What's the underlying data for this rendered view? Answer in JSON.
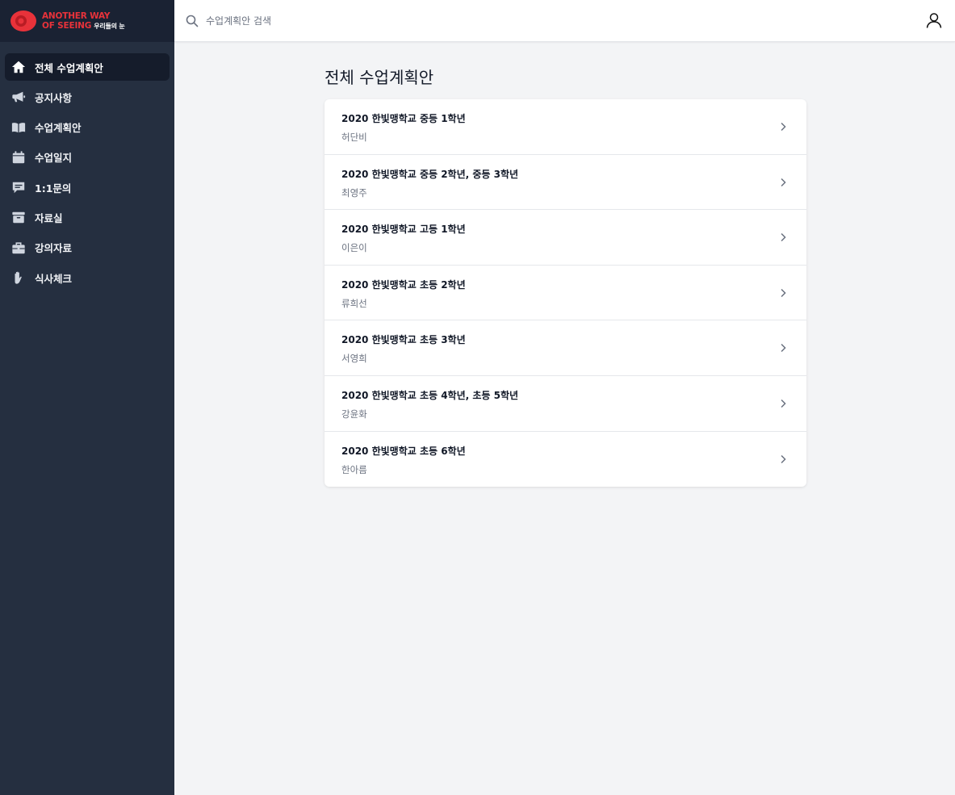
{
  "brand": {
    "line1": "ANOTHER WAY",
    "line2": "OF SEEING",
    "ko": "우리들의 눈",
    "color": "#e8323a"
  },
  "sidebar": {
    "items": [
      {
        "label": "전체 수업계획안",
        "icon": "home-icon",
        "active": true
      },
      {
        "label": "공지사항",
        "icon": "megaphone-icon"
      },
      {
        "label": "수업계획안",
        "icon": "book-open-icon"
      },
      {
        "label": "수업일지",
        "icon": "calendar-icon"
      },
      {
        "label": "1:1문의",
        "icon": "chat-icon"
      },
      {
        "label": "자료실",
        "icon": "archive-icon"
      },
      {
        "label": "강의자료",
        "icon": "briefcase-icon"
      },
      {
        "label": "식사체크",
        "icon": "hand-icon"
      }
    ]
  },
  "search": {
    "placeholder": "수업계획안 검색"
  },
  "main": {
    "title": "전체 수업계획안",
    "rows": [
      {
        "title": "2020 한빛맹학교 중등 1학년",
        "teacher": "허단비"
      },
      {
        "title": "2020 한빛맹학교 중등 2학년, 중등 3학년",
        "teacher": "최영주"
      },
      {
        "title": "2020 한빛맹학교 고등 1학년",
        "teacher": "이은이"
      },
      {
        "title": "2020 한빛맹학교 초등 2학년",
        "teacher": "류희선"
      },
      {
        "title": "2020 한빛맹학교 초등 3학년",
        "teacher": "서영희"
      },
      {
        "title": "2020 한빛맹학교 초등 4학년, 초등 5학년",
        "teacher": "강윤화"
      },
      {
        "title": "2020 한빛맹학교 초등 6학년",
        "teacher": "한아름"
      }
    ]
  }
}
